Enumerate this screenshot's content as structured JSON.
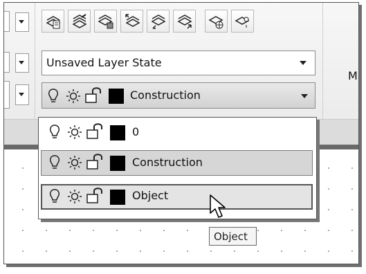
{
  "ribbon": {
    "layer_state_value": "Unsaved Layer State",
    "side_label": "Mu",
    "tool_icons": [
      "layer-properties-icon",
      "layer-states-icon",
      "make-current-icon",
      "match-layer-icon",
      "layer-previous-icon",
      "layer-isolate-icon",
      "freeze-layer-icon",
      "layer-off-icon"
    ]
  },
  "layer_combo": {
    "current": "Construction"
  },
  "dropdown": {
    "items": [
      {
        "name": "0"
      },
      {
        "name": "Construction"
      },
      {
        "name": "Object"
      }
    ]
  },
  "tooltip": {
    "text": "Object"
  },
  "colors": {
    "swatch": "#000000",
    "highlight": "#d6d6d6"
  }
}
